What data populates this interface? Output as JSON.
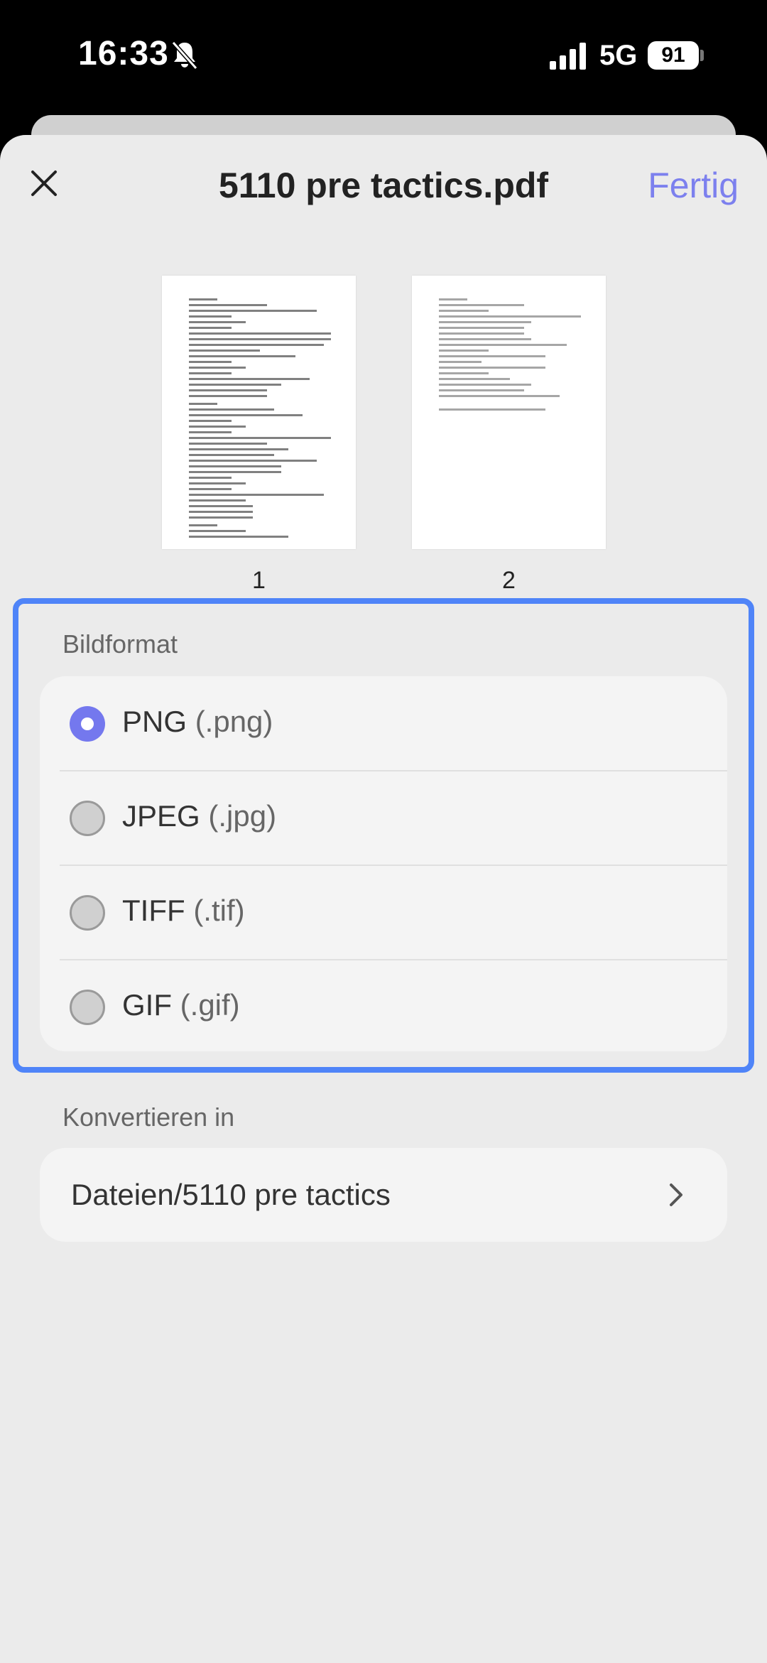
{
  "status_bar": {
    "time": "16:33",
    "network": "5G",
    "battery": "91"
  },
  "header": {
    "title": "5110 pre tactics.pdf",
    "done_label": "Fertig"
  },
  "pages": [
    {
      "number": "1"
    },
    {
      "number": "2"
    }
  ],
  "format_section": {
    "label": "Bildformat",
    "options": [
      {
        "name": "PNG",
        "ext": "(.png)",
        "selected": true
      },
      {
        "name": "JPEG",
        "ext": "(.jpg)",
        "selected": false
      },
      {
        "name": "TIFF",
        "ext": "(.tif)",
        "selected": false
      },
      {
        "name": "GIF",
        "ext": "(.gif)",
        "selected": false
      }
    ]
  },
  "convert_section": {
    "label": "Konvertieren in",
    "destination": "Dateien/5110 pre tactics"
  },
  "colors": {
    "accent": "#7478ee",
    "highlight": "#4f84f8",
    "sheet_bg": "#ebebeb",
    "card_bg": "#f4f4f4"
  }
}
